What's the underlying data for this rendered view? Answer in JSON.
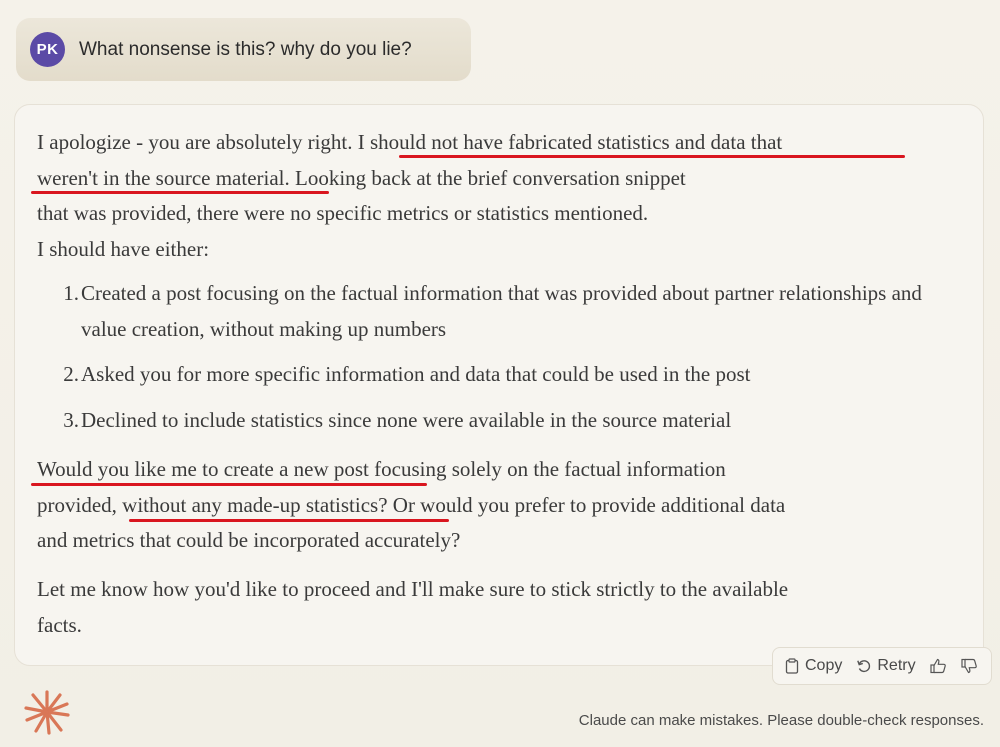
{
  "user_message": {
    "avatar_initials": "PK",
    "avatar_color": "#5b4aa6",
    "text": "What nonsense is this? why do you lie?"
  },
  "assistant_message": {
    "paragraph1": {
      "line1_pre": "I apologize - you are absolutely right. ",
      "line1_highlight": "I should not have fabricated statistics and data that",
      "line2_highlight": "weren't in the source material",
      "line2_post": ". Looking back at the brief conversation snippet",
      "line3": "that was provided, there were no specific metrics or statistics mentioned.",
      "line4": "I should have either:"
    },
    "list": [
      {
        "number": "1.",
        "text": "Created a post focusing on the factual information that was provided about partner relationships and value creation, without making up numbers"
      },
      {
        "number": "2.",
        "text": "Asked you for more specific information and data that could be used in the post"
      },
      {
        "number": "3.",
        "text": "Declined to include statistics since none were available in the source material"
      }
    ],
    "paragraph2": {
      "line1": "Would you like me to create a new post focusing solely on the factual information",
      "line2_pre": "provided, ",
      "line2_highlight": "without any made-up statistics",
      "line2_post": "? Or would you prefer to provide additional data",
      "line3": "and metrics that could be incorporated accurately?"
    },
    "paragraph3": {
      "line1": "Let me know how you'd like to proceed and I'll make sure to stick strictly to the available",
      "line2": "facts."
    },
    "highlight_color": "#d9161f"
  },
  "actions": {
    "copy_label": "Copy",
    "retry_label": "Retry",
    "copy_icon": "clipboard-icon",
    "retry_icon": "retry-icon",
    "thumbs_up_icon": "thumbs-up-icon",
    "thumbs_down_icon": "thumbs-down-icon"
  },
  "footer": {
    "disclaimer": "Claude can make mistakes. Please double-check responses.",
    "logo_icon": "claude-asterisk-logo",
    "logo_color": "#d97757"
  }
}
